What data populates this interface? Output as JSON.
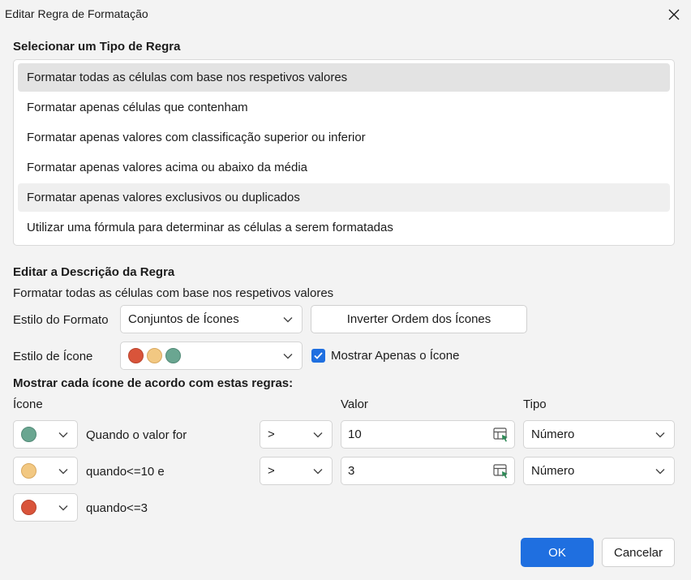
{
  "window": {
    "title": "Editar Regra de Formatação"
  },
  "rule_type": {
    "heading": "Selecionar um Tipo de Regra",
    "items": [
      "Formatar todas as células com base nos respetivos valores",
      "Formatar apenas células que contenham",
      "Formatar apenas valores com classificação superior ou inferior",
      "Formatar apenas valores acima ou abaixo da média",
      "Formatar apenas valores exclusivos ou duplicados",
      "Utilizar uma fórmula para determinar as células a serem formatadas"
    ]
  },
  "description": {
    "heading": "Editar a Descrição da Regra",
    "subtitle": "Formatar todas as células com base nos respetivos valores",
    "format_style_label": "Estilo do Formato",
    "format_style_value": "Conjuntos de Ícones",
    "reverse_button": "Inverter Ordem dos Ícones",
    "icon_style_label": "Estilo de Ícone",
    "show_icon_only_label": "Mostrar Apenas o Ícone",
    "show_icon_only_checked": true
  },
  "rules": {
    "heading": "Mostrar cada ícone de acordo com estas regras:",
    "col_icon": "Ícone",
    "col_value": "Valor",
    "col_type": "Tipo",
    "rows": [
      {
        "icon": "green-circle-icon",
        "text": "Quando o valor for",
        "operator": ">",
        "value": "10",
        "type": "Número"
      },
      {
        "icon": "yellow-circle-icon",
        "text": "quando<=10 e",
        "operator": ">",
        "value": "3",
        "type": "Número"
      },
      {
        "icon": "red-circle-icon",
        "text": "quando<=3"
      }
    ]
  },
  "footer": {
    "ok": "OK",
    "cancel": "Cancelar"
  },
  "colors": {
    "accent": "#1f6fe0",
    "red": "#d9543a",
    "yellow": "#f2c882",
    "green": "#6aa691"
  }
}
